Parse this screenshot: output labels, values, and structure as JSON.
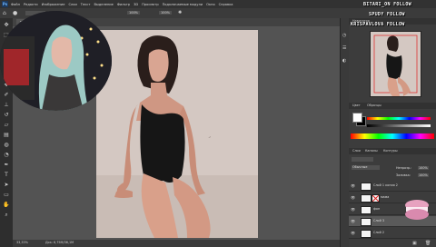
{
  "app": {
    "menu": [
      "Файл",
      "Редакти",
      "Изображение",
      "Слои",
      "Текст",
      "Выделение",
      "Фильтр",
      "3D",
      "Просмотр",
      "Подключаемые модули",
      "Окно",
      "Справка"
    ],
    "options": {
      "zoom": "100%",
      "flow": "100%"
    },
    "document_tab": "ss.psd @ 33,3% (Слой 3, RGB/8) *",
    "status": {
      "zoom": "33,33%",
      "doc": "Док: 6,75M/36,1M"
    }
  },
  "panels": {
    "navigator_tab": "Навигатор",
    "color_tabs": [
      "Цвет",
      "Образцы"
    ],
    "layers_tabs": [
      "Слои",
      "Каналы",
      "Контуры"
    ],
    "blend_mode": "Обычные",
    "opacity_label": "Непрозр.:",
    "opacity": "100%",
    "fill_label": "Заливка:",
    "fill": "100%",
    "layers": [
      {
        "name": "Слой 1 копия 2",
        "selected": false
      },
      {
        "name": "мама",
        "selected": false,
        "has_mask": true
      },
      {
        "name": "фон",
        "selected": false
      },
      {
        "name": "Слой 3",
        "selected": true
      },
      {
        "name": "Слой 2",
        "selected": false
      }
    ]
  },
  "overlay": {
    "line1": "BITARI_ON  FOLLOW",
    "line2": "SPUDY  FOLLOW",
    "line3": "KRISPAVLOVA  FOLLOW"
  },
  "colors": {
    "foreground": "#ffffff",
    "background": "#000000",
    "accent_selection": "#5a5a5a"
  },
  "icons": {
    "tools": [
      "move-icon",
      "marquee-icon",
      "lasso-icon",
      "magic-wand-icon",
      "crop-icon",
      "eyedropper-icon",
      "healing-icon",
      "brush-icon",
      "stamp-icon",
      "history-brush-icon",
      "eraser-icon",
      "gradient-icon",
      "blur-icon",
      "dodge-icon",
      "pen-icon",
      "text-icon",
      "path-select-icon",
      "rectangle-icon",
      "hand-icon",
      "zoom-icon"
    ]
  }
}
